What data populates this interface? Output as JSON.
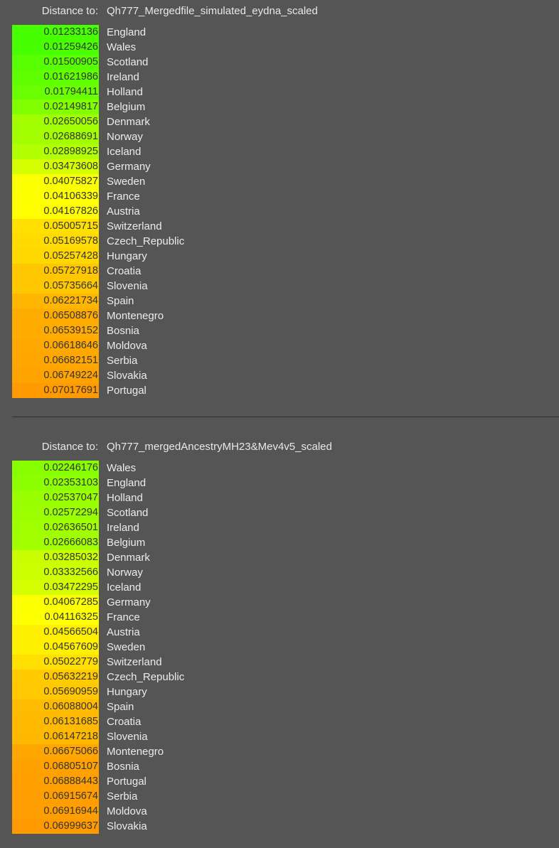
{
  "sections": [
    {
      "label": "Distance to:",
      "target": "Qh777_Mergedfile_simulated_eydna_scaled",
      "rows": [
        {
          "distance": "0.01233136",
          "population": "England"
        },
        {
          "distance": "0.01259426",
          "population": "Wales"
        },
        {
          "distance": "0.01500905",
          "population": "Scotland"
        },
        {
          "distance": "0.01621986",
          "population": "Ireland"
        },
        {
          "distance": "0.01794411",
          "population": "Holland"
        },
        {
          "distance": "0.02149817",
          "population": "Belgium"
        },
        {
          "distance": "0.02650056",
          "population": "Denmark"
        },
        {
          "distance": "0.02688691",
          "population": "Norway"
        },
        {
          "distance": "0.02898925",
          "population": "Iceland"
        },
        {
          "distance": "0.03473608",
          "population": "Germany"
        },
        {
          "distance": "0.04075827",
          "population": "Sweden"
        },
        {
          "distance": "0.04106339",
          "population": "France"
        },
        {
          "distance": "0.04167826",
          "population": "Austria"
        },
        {
          "distance": "0.05005715",
          "population": "Switzerland"
        },
        {
          "distance": "0.05169578",
          "population": "Czech_Republic"
        },
        {
          "distance": "0.05257428",
          "population": "Hungary"
        },
        {
          "distance": "0.05727918",
          "population": "Croatia"
        },
        {
          "distance": "0.05735664",
          "population": "Slovenia"
        },
        {
          "distance": "0.06221734",
          "population": "Spain"
        },
        {
          "distance": "0.06508876",
          "population": "Montenegro"
        },
        {
          "distance": "0.06539152",
          "population": "Bosnia"
        },
        {
          "distance": "0.06618646",
          "population": "Moldova"
        },
        {
          "distance": "0.06682151",
          "population": "Serbia"
        },
        {
          "distance": "0.06749224",
          "population": "Slovakia"
        },
        {
          "distance": "0.07017691",
          "population": "Portugal"
        }
      ]
    },
    {
      "label": "Distance to:",
      "target": "Qh777_mergedAncestryMH23&Mev4v5_scaled",
      "rows": [
        {
          "distance": "0.02246176",
          "population": "Wales"
        },
        {
          "distance": "0.02353103",
          "population": "England"
        },
        {
          "distance": "0.02537047",
          "population": "Holland"
        },
        {
          "distance": "0.02572294",
          "population": "Scotland"
        },
        {
          "distance": "0.02636501",
          "population": "Ireland"
        },
        {
          "distance": "0.02666083",
          "population": "Belgium"
        },
        {
          "distance": "0.03285032",
          "population": "Denmark"
        },
        {
          "distance": "0.03332566",
          "population": "Norway"
        },
        {
          "distance": "0.03472295",
          "population": "Iceland"
        },
        {
          "distance": "0.04067285",
          "population": "Germany"
        },
        {
          "distance": "0.04116325",
          "population": "France"
        },
        {
          "distance": "0.04566504",
          "population": "Austria"
        },
        {
          "distance": "0.04567609",
          "population": "Sweden"
        },
        {
          "distance": "0.05022779",
          "population": "Switzerland"
        },
        {
          "distance": "0.05632219",
          "population": "Czech_Republic"
        },
        {
          "distance": "0.05690959",
          "population": "Hungary"
        },
        {
          "distance": "0.06088004",
          "population": "Spain"
        },
        {
          "distance": "0.06131685",
          "population": "Croatia"
        },
        {
          "distance": "0.06147218",
          "population": "Slovenia"
        },
        {
          "distance": "0.06675066",
          "population": "Montenegro"
        },
        {
          "distance": "0.06805107",
          "population": "Bosnia"
        },
        {
          "distance": "0.06888443",
          "population": "Portugal"
        },
        {
          "distance": "0.06915674",
          "population": "Serbia"
        },
        {
          "distance": "0.06916944",
          "population": "Moldova"
        },
        {
          "distance": "0.06999637",
          "population": "Slovakia"
        }
      ]
    }
  ],
  "colors": {
    "background": "#555555",
    "divider": "#2f2f2f",
    "scale_low": "#44ff00",
    "scale_mid": "#ffff00",
    "scale_high": "#ff9900"
  }
}
